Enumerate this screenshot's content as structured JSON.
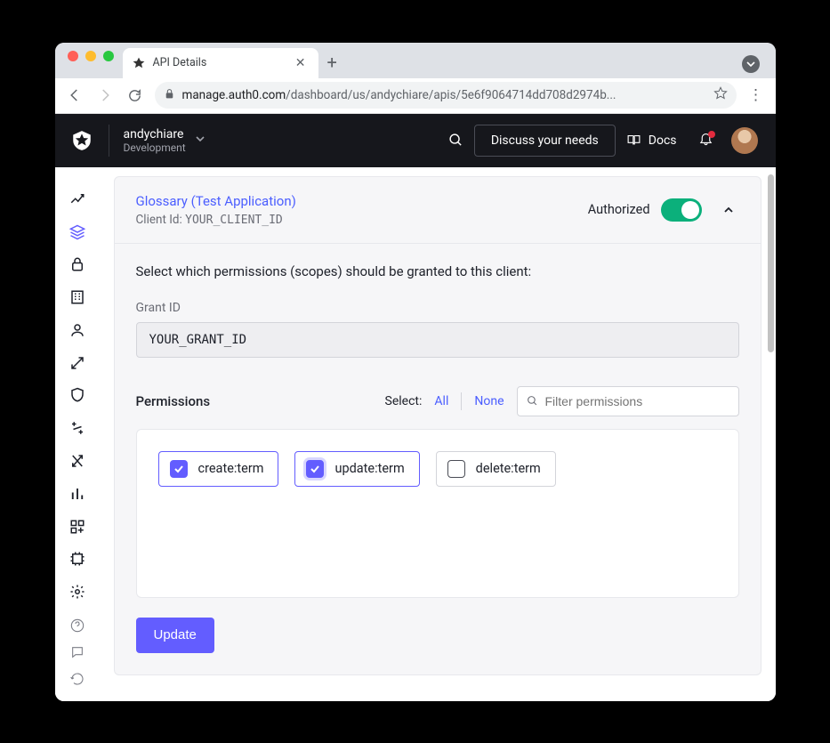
{
  "browser": {
    "tab_title": "API Details",
    "url_host": "manage.auth0.com",
    "url_path": "/dashboard/us/andychiare/apis/5e6f9064714dd708d2974b..."
  },
  "header": {
    "tenant_name": "andychiare",
    "tenant_env": "Development",
    "discuss_label": "Discuss your needs",
    "docs_label": "Docs"
  },
  "panel": {
    "app_link": "Glossary (Test Application)",
    "client_id_label": "Client Id:",
    "client_id_value": "YOUR_CLIENT_ID",
    "authorized_label": "Authorized",
    "lead": "Select which permissions (scopes) should be granted to this client:",
    "grant_label": "Grant ID",
    "grant_value": "YOUR_GRANT_ID",
    "permissions_title": "Permissions",
    "select_label": "Select:",
    "select_all": "All",
    "select_none": "None",
    "filter_placeholder": "Filter permissions",
    "update_label": "Update"
  },
  "permissions": [
    {
      "scope": "create:term",
      "checked": true,
      "focused": false
    },
    {
      "scope": "update:term",
      "checked": true,
      "focused": true
    },
    {
      "scope": "delete:term",
      "checked": false,
      "focused": false
    }
  ]
}
